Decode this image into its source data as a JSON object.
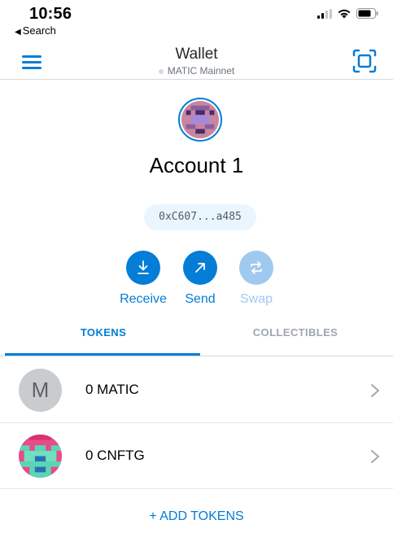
{
  "status_bar": {
    "time": "10:56",
    "back_label": "Search",
    "icons": [
      "signal-icon",
      "wifi-icon",
      "battery-icon"
    ]
  },
  "navbar": {
    "title": "Wallet",
    "network": "MATIC Mainnet",
    "menu_icon": "hamburger-menu-icon",
    "scan_icon": "qr-scan-icon"
  },
  "account": {
    "name": "Account 1",
    "address": "0xC607...a485"
  },
  "actions": [
    {
      "label": "Receive",
      "icon": "download-icon",
      "enabled": true
    },
    {
      "label": "Send",
      "icon": "arrow-up-right-icon",
      "enabled": true
    },
    {
      "label": "Swap",
      "icon": "swap-icon",
      "enabled": false
    }
  ],
  "tabs": [
    {
      "label": "TOKENS",
      "active": true
    },
    {
      "label": "COLLECTIBLES",
      "active": false
    }
  ],
  "tokens": [
    {
      "icon_letter": "M",
      "balance": "0 MATIC"
    },
    {
      "icon_letter": "",
      "balance": "0 CNFTG"
    }
  ],
  "add_tokens_label": "+ ADD TOKENS",
  "colors": {
    "accent": "#037dd6",
    "accent_disabled": "#a0c9f0",
    "address_pill_bg": "#eaf6ff"
  }
}
